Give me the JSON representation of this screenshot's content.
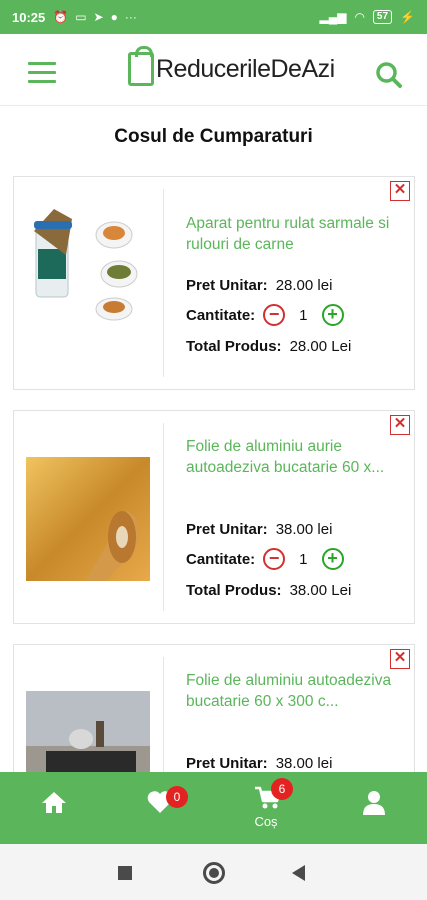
{
  "status_bar": {
    "time": "10:25",
    "battery": "57"
  },
  "header": {
    "logo_text": "ReducerileDeAzi"
  },
  "page": {
    "title": "Cosul de Cumparaturi"
  },
  "labels": {
    "unit_price": "Pret Unitar:",
    "quantity": "Cantitate:",
    "total": "Total Produs:"
  },
  "cart_items": [
    {
      "title": "Aparat  pentru rulat sarmale si rulouri de carne",
      "unit_price": "28.00 lei",
      "quantity": "1",
      "total": "28.00 Lei"
    },
    {
      "title": "Folie de aluminiu aurie autoadeziva bucatarie 60 x...",
      "unit_price": "38.00 lei",
      "quantity": "1",
      "total": "38.00 Lei"
    },
    {
      "title": "Folie de aluminiu autoadeziva bucatarie 60 x 300 c...",
      "unit_price": "38.00 lei"
    }
  ],
  "bottom_nav": {
    "wishlist_count": "0",
    "cart_count": "6",
    "cart_label": "Coș"
  },
  "colors": {
    "brand_green": "#5bb65b",
    "remove_red": "#d23030",
    "badge_red": "#e52222"
  }
}
